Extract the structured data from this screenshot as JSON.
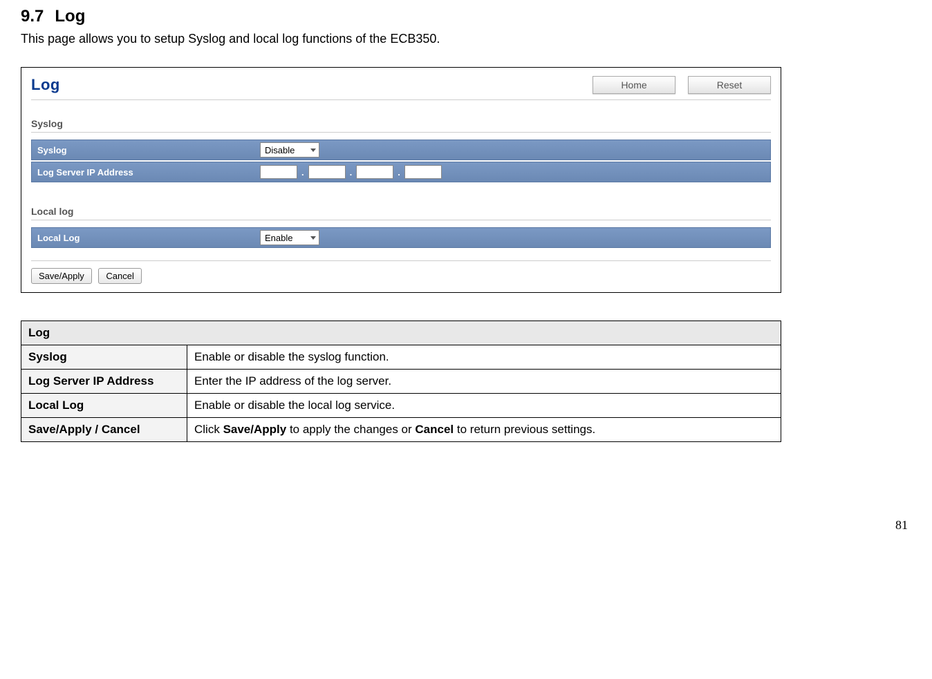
{
  "page": {
    "section_number": "9.7",
    "section_title": "Log",
    "intro": "This page allows you to setup Syslog and local log functions of the ECB350.",
    "page_number": "81"
  },
  "app": {
    "title": "Log",
    "home_btn": "Home",
    "reset_btn": "Reset",
    "syslog_heading": "Syslog",
    "syslog_label": "Syslog",
    "syslog_value": "Disable",
    "ip_label": "Log Server IP Address",
    "dot": ".",
    "locallog_heading": "Local log",
    "locallog_label": "Local Log",
    "locallog_value": "Enable",
    "save_apply": "Save/Apply",
    "cancel": "Cancel"
  },
  "table": {
    "header": "Log",
    "rows": {
      "syslog": {
        "label": "Syslog",
        "desc": "Enable or disable the syslog function."
      },
      "ip": {
        "label": "Log Server IP Address",
        "desc": "Enter the IP address of the log server."
      },
      "local": {
        "label": "Local Log",
        "desc": "Enable or disable the local log service."
      },
      "save": {
        "label": "Save/Apply / Cancel",
        "desc_pre": "Click ",
        "desc_b1": "Save/Apply",
        "desc_mid": " to apply the changes or ",
        "desc_b2": "Cancel",
        "desc_post": " to return previous settings."
      }
    }
  }
}
